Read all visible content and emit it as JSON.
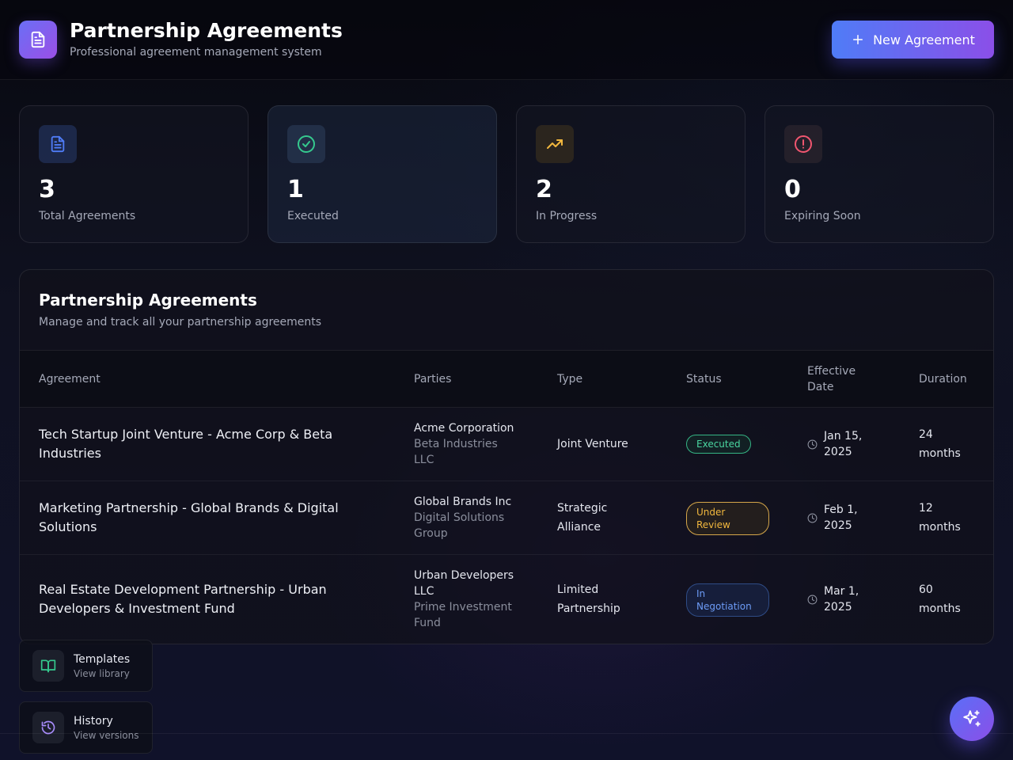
{
  "header": {
    "title": "Partnership Agreements",
    "subtitle": "Professional agreement management system",
    "logo_icon": "document-icon",
    "new_button_label": "New Agreement"
  },
  "stats": [
    {
      "value": "3",
      "label": "Total Agreements",
      "icon": "document-icon",
      "color": "#4f7cf7"
    },
    {
      "value": "1",
      "label": "Executed",
      "icon": "check-circle-icon",
      "color": "#35c98e"
    },
    {
      "value": "2",
      "label": "In Progress",
      "icon": "trending-up-icon",
      "color": "#f1b73e"
    },
    {
      "value": "0",
      "label": "Expiring Soon",
      "icon": "alert-circle-icon",
      "color": "#f0566f"
    }
  ],
  "table": {
    "title": "Partnership Agreements",
    "subtitle": "Manage and track all your partnership agreements",
    "columns": {
      "agreement": "Agreement",
      "parties": "Parties",
      "type": "Type",
      "status": "Status",
      "effective_1": "Effective",
      "effective_2": "Date",
      "duration": "Duration"
    },
    "rows": [
      {
        "name_1": "Tech Startup Joint Venture - Acme Corp & Beta",
        "name_2": "Industries",
        "party_1": "Acme Corporation",
        "party_2a": "Beta Industries",
        "party_2b": "LLC",
        "type_1": "Joint Venture",
        "status_1": "Executed",
        "date_1": "Jan 15,",
        "date_2": "2025",
        "dur_1": "24",
        "dur_2": "months"
      },
      {
        "name_1": "Marketing Partnership - Global Brands & Digital",
        "name_2": "Solutions",
        "party_1": "Global Brands Inc",
        "party_2a": "Digital Solutions",
        "party_2b": "Group",
        "type_1": "Strategic",
        "type_2": "Alliance",
        "status_1": "Under",
        "status_2": "Review",
        "date_1": "Feb 1,",
        "date_2": "2025",
        "dur_1": "12",
        "dur_2": "months"
      },
      {
        "name_1": "Real Estate Development Partnership - Urban",
        "name_2": "Developers & Investment Fund",
        "party_1a": "Urban Developers",
        "party_1b": "LLC",
        "party_2a": "Prime Investment",
        "party_2b": "Fund",
        "type_1": "Limited",
        "type_2": "Partnership",
        "status_1": "In",
        "status_2": "Negotiation",
        "date_1": "Mar 1,",
        "date_2": "2025",
        "dur_1": "60",
        "dur_2": "months"
      }
    ]
  },
  "quick_actions": [
    {
      "title": "Templates",
      "subtitle": "View library",
      "icon": "book-open-icon"
    },
    {
      "title": "History",
      "subtitle": "View versions",
      "icon": "history-icon"
    }
  ],
  "fab_icon": "sparkles-icon"
}
